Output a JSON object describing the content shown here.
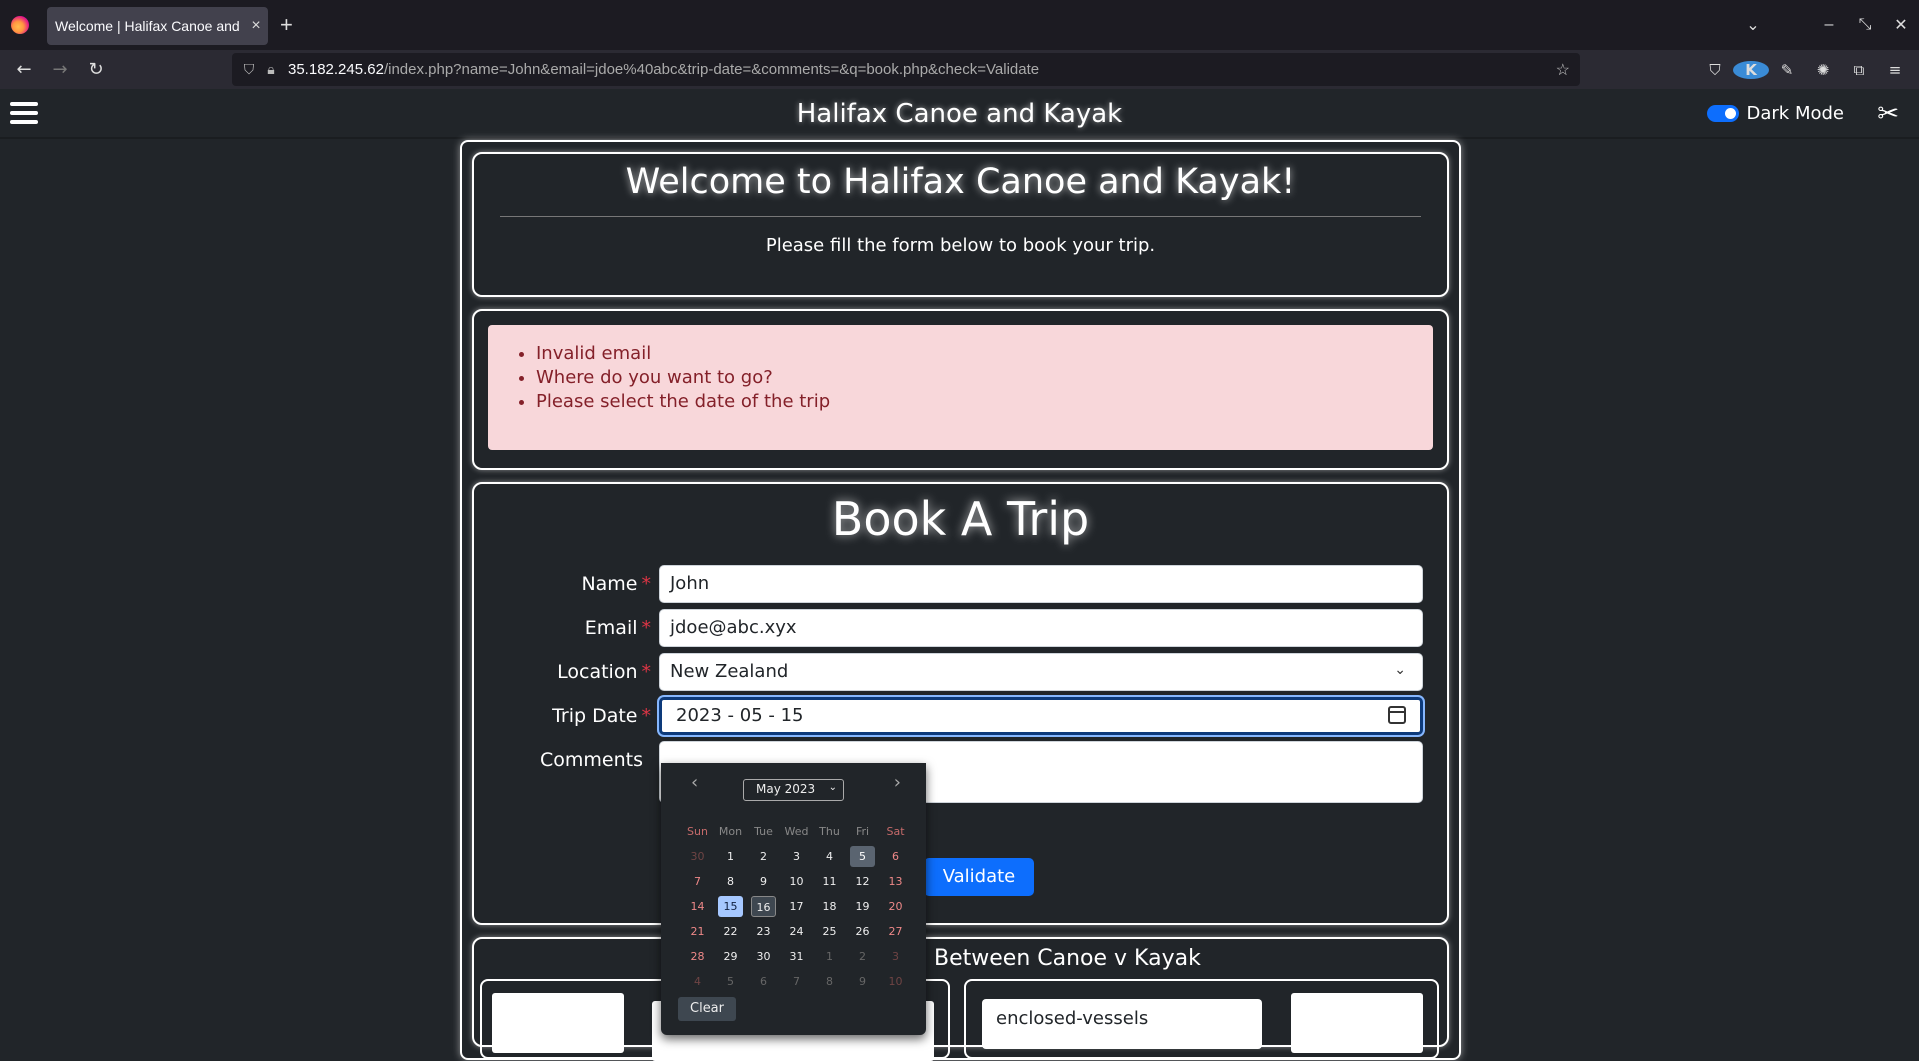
{
  "browser": {
    "tab_title": "Welcome | Halifax Canoe and",
    "tab_close": "×",
    "new_tab": "+",
    "url_host": "35.182.245.62",
    "url_path": "/index.php?name=John&email=jdoe%40abc&trip-date=&comments=&q=book.php&check=Validate",
    "ext_k": "K"
  },
  "header": {
    "site_title": "Halifax Canoe and Kayak",
    "dark_mode_label": "Dark Mode",
    "dark_mode_on": true
  },
  "welcome": {
    "heading": "Welcome to Halifax Canoe and Kayak!",
    "subtext": "Please fill the form below to book your trip."
  },
  "errors": [
    "Invalid email",
    "Where do you want to go?",
    "Please select the date of the trip"
  ],
  "form": {
    "heading": "Book A Trip",
    "name_label": "Name",
    "name_value": "John",
    "email_label": "Email",
    "email_value": "jdoe@abc.xyx",
    "location_label": "Location",
    "location_value": "New Zealand",
    "date_label": "Trip Date",
    "date_value": "2023 - 05 - 15",
    "comments_label": "Comments",
    "required_mark": "*",
    "validate_label": "Validate"
  },
  "diff": {
    "title": "Between Canoe v Kayak",
    "tag": "enclosed-vessels"
  },
  "datepicker": {
    "month_label": "May 2023",
    "clear_label": "Clear",
    "days_of_week": [
      "Sun",
      "Mon",
      "Tue",
      "Wed",
      "Thu",
      "Fri",
      "Sat"
    ],
    "weeks": [
      [
        "30",
        "1",
        "2",
        "3",
        "4",
        "5",
        "6"
      ],
      [
        "7",
        "8",
        "9",
        "10",
        "11",
        "12",
        "13"
      ],
      [
        "14",
        "15",
        "16",
        "17",
        "18",
        "19",
        "20"
      ],
      [
        "21",
        "22",
        "23",
        "24",
        "25",
        "26",
        "27"
      ],
      [
        "28",
        "29",
        "30",
        "31",
        "1",
        "2",
        "3"
      ],
      [
        "4",
        "5",
        "6",
        "7",
        "8",
        "9",
        "10"
      ]
    ],
    "selected": "15",
    "today": "5",
    "focused": "16"
  }
}
